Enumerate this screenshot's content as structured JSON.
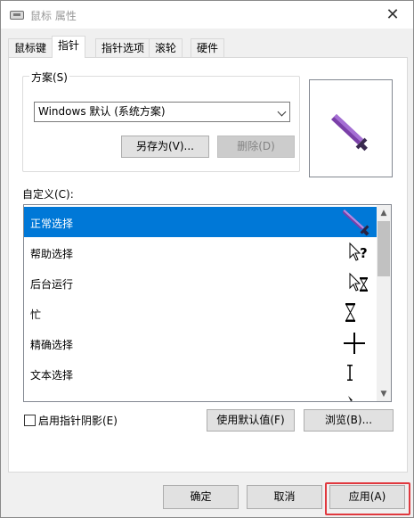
{
  "window": {
    "title": "鼠标 属性",
    "close_label": "✕"
  },
  "tabs": [
    {
      "label": "鼠标键",
      "active": false
    },
    {
      "label": "指针",
      "active": true
    },
    {
      "label": "指针选项",
      "active": false
    },
    {
      "label": "滚轮",
      "active": false
    },
    {
      "label": "硬件",
      "active": false
    }
  ],
  "scheme": {
    "group_label": "方案(S)",
    "selected": "Windows 默认 (系统方案)",
    "save_as_label": "另存为(V)...",
    "delete_label": "删除(D)"
  },
  "customize": {
    "label": "自定义(C):",
    "items": [
      {
        "label": "正常选择",
        "icon": "sword-cursor-icon",
        "selected": true
      },
      {
        "label": "帮助选择",
        "icon": "help-select-cursor-icon",
        "selected": false
      },
      {
        "label": "后台运行",
        "icon": "working-in-background-cursor-icon",
        "selected": false
      },
      {
        "label": "忙",
        "icon": "busy-hourglass-cursor-icon",
        "selected": false
      },
      {
        "label": "精确选择",
        "icon": "precision-crosshair-cursor-icon",
        "selected": false
      },
      {
        "label": "文本选择",
        "icon": "text-ibeam-cursor-icon",
        "selected": false
      },
      {
        "label": "",
        "icon": "handwriting-pen-cursor-icon",
        "selected": false
      }
    ]
  },
  "options": {
    "shadow_label": "启用指针阴影(E)",
    "shadow_checked": false,
    "use_default_label": "使用默认值(F)",
    "browse_label": "浏览(B)..."
  },
  "footer": {
    "ok_label": "确定",
    "cancel_label": "取消",
    "apply_label": "应用(A)"
  },
  "colors": {
    "selection": "#0078d7",
    "sword": "#7a3fa8",
    "highlight": "#e0383e"
  }
}
